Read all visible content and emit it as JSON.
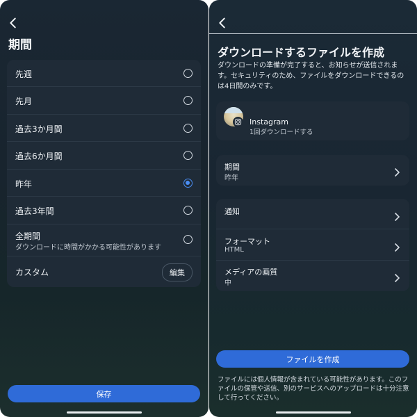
{
  "left": {
    "title": "期間",
    "options": [
      {
        "label": "先週",
        "selected": false
      },
      {
        "label": "先月",
        "selected": false
      },
      {
        "label": "過去3か月間",
        "selected": false
      },
      {
        "label": "過去6か月間",
        "selected": false
      },
      {
        "label": "昨年",
        "selected": true
      },
      {
        "label": "過去3年間",
        "selected": false
      },
      {
        "label": "全期間",
        "sub": "ダウンロードに時間がかかる可能性があります",
        "selected": false
      }
    ],
    "custom_label": "カスタム",
    "edit_label": "編集",
    "save_label": "保存"
  },
  "right": {
    "title": "ダウンロードするファイルを作成",
    "description": "ダウンロードの準備が完了すると、お知らせが送信されます。セキュリティのため、ファイルをダウンロードできるのは4日間のみです。",
    "account": {
      "name": "Instagram",
      "detail": "1回ダウンロードする"
    },
    "period": {
      "label": "期間",
      "value": "昨年"
    },
    "notify_label": "通知",
    "format": {
      "label": "フォーマット",
      "value": "HTML"
    },
    "quality": {
      "label": "メディアの画質",
      "value": "中"
    },
    "create_label": "ファイルを作成",
    "footer": "ファイルには個人情報が含まれている可能性があります。このファイルの保管や送信、別のサービスへのアップロードは十分注意して行ってください。"
  },
  "colors": {
    "accent": "#2f6bd8",
    "radio_selected": "#4a8ef5",
    "card": "#1f2b37"
  },
  "icons": [
    "back-arrow-icon",
    "radio-icon",
    "chevron-right-icon",
    "instagram-icon"
  ]
}
